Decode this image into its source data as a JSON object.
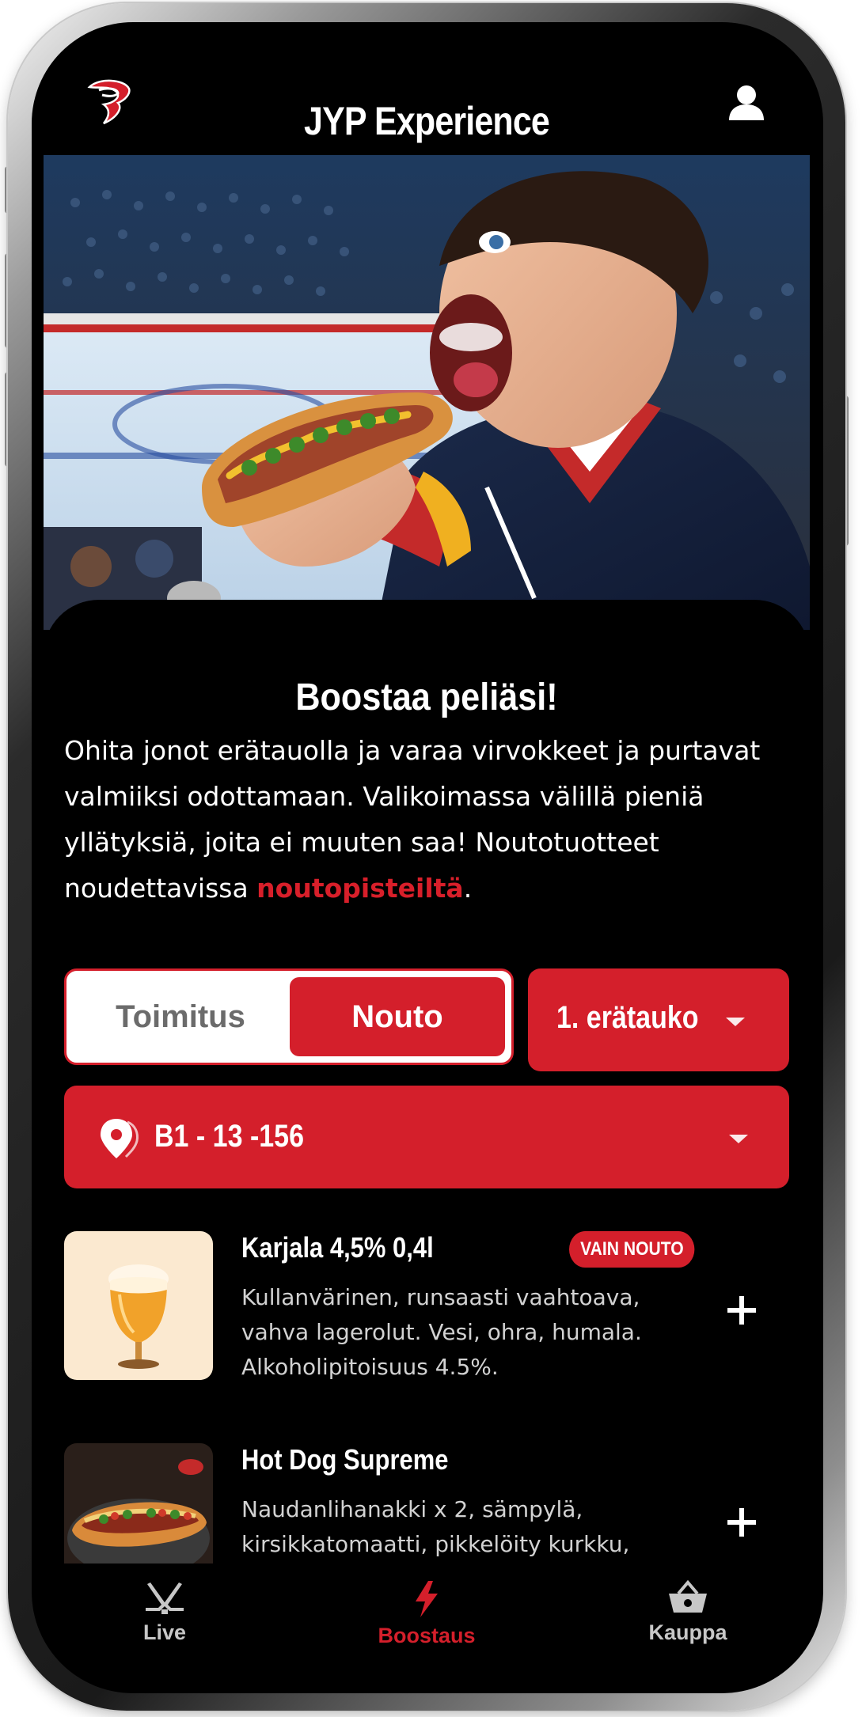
{
  "header": {
    "title": "JYP Experience",
    "logo_icon": "jyp-logo-icon",
    "user_icon": "user-icon"
  },
  "hero": {
    "alt": "Hockey fan eating a hot dog in the arena"
  },
  "intro": {
    "title": "Boostaa peliäsi!",
    "desc_before": "Ohita jonot erätauolla ja varaa virvokkeet ja purtavat valmiiksi odottamaan. Valikoimassa välillä pieniä yllätyksiä, joita ei muuten saa! Noutotuotteet noudettavissa ",
    "desc_link": "noutopisteiltä",
    "desc_after": "."
  },
  "delivery_toggle": {
    "option_delivery": "Toimitus",
    "option_pickup": "Nouto",
    "selected": "Nouto"
  },
  "break_select": {
    "value": "1. erätauko"
  },
  "seat_select": {
    "value": "B1 - 13 -156"
  },
  "products": [
    {
      "name": "Karjala 4,5% 0,4l",
      "badge": "VAIN NOUTO",
      "description": "Kullanvärinen, runsaasti vaahtoava, vahva lagerolut. Vesi, ohra, humala. Alkoholipitoisuus 4.5%.",
      "image_icon": "beer-glass-image"
    },
    {
      "name": "Hot Dog Supreme",
      "badge": "",
      "description": "Naudanlihanakki x 2, sämpylä, kirsikkatomaatti, pikkelöity kurkku, pikkelöity sipuli, paprika, majoneesi.",
      "image_icon": "hot-dog-image"
    }
  ],
  "bottom_nav": {
    "items": [
      {
        "label": "Live",
        "icon": "hockey-sticks-icon",
        "active": false
      },
      {
        "label": "Boostaus",
        "icon": "lightning-bolt-icon",
        "active": true
      },
      {
        "label": "Kauppa",
        "icon": "basket-icon",
        "active": false
      }
    ]
  },
  "colors": {
    "accent": "#d41f2b",
    "background": "#000000",
    "text": "#ffffff",
    "muted_text": "#d2d2d2",
    "inactive_nav": "#c7c7c7"
  }
}
